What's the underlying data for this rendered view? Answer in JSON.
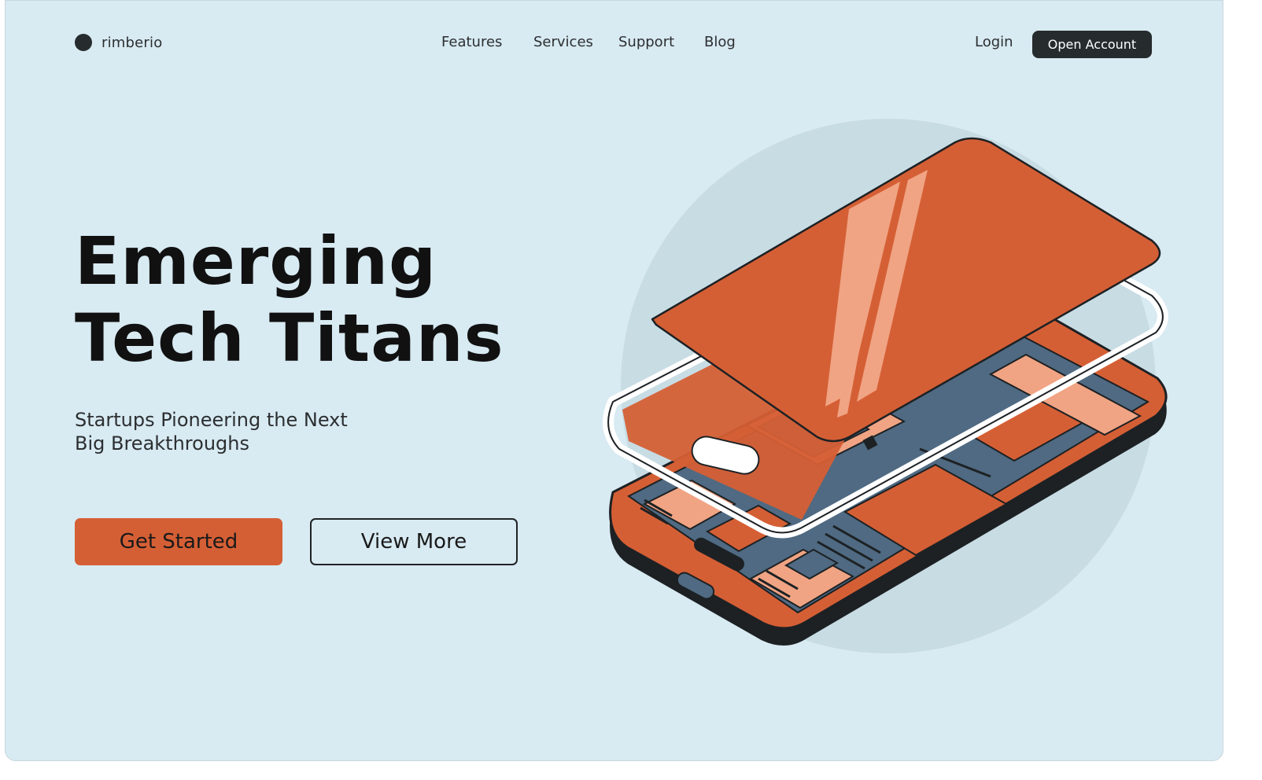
{
  "header": {
    "brand_name": "rimberio",
    "nav_items": [
      {
        "label": "Features"
      },
      {
        "label": "Services"
      },
      {
        "label": "Support"
      },
      {
        "label": "Blog"
      }
    ],
    "login_label": "Login",
    "open_account_label": "Open Account"
  },
  "hero": {
    "title_line1": "Emerging",
    "title_line2": "Tech Titans",
    "subtitle_line1": "Startups Pioneering the Next",
    "subtitle_line2": "Big Breakthroughs",
    "primary_button": "Get Started",
    "secondary_button": "View More"
  },
  "colors": {
    "background": "#d8eaf2",
    "accent": "#d55f35",
    "accent_light": "#f0a483",
    "dark": "#262b2e",
    "board": "#4f6a82",
    "circle": "#c8dce4"
  },
  "illustration": {
    "icon": "isometric-smartphone-illustration"
  }
}
